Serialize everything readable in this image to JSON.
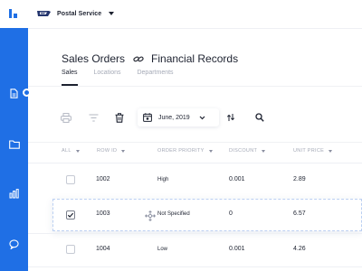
{
  "brand": {
    "name": "Postal Service"
  },
  "page": {
    "title_left": "Sales Orders",
    "title_right": "Financial Records"
  },
  "tabs": [
    {
      "label": "Sales",
      "active": true
    },
    {
      "label": "Locations",
      "active": false
    },
    {
      "label": "Departments",
      "active": false
    }
  ],
  "toolbar": {
    "date_label": "June, 2019"
  },
  "table": {
    "columns": [
      "ALL",
      "ROW ID",
      "ORDER PRIORITY",
      "DISCOUNT",
      "UNIT PRICE"
    ],
    "rows": [
      {
        "checked": false,
        "row_id": "1002",
        "priority": "High",
        "discount": "0.001",
        "unit_price": "2.89"
      },
      {
        "checked": true,
        "row_id": "1003",
        "priority": "Not Specified",
        "discount": "0",
        "unit_price": "6.57"
      },
      {
        "checked": false,
        "row_id": "1004",
        "priority": "Low",
        "discount": "0.001",
        "unit_price": "4.26"
      }
    ]
  },
  "colors": {
    "accent": "#1f6fe5",
    "text": "#1d2230",
    "muted": "#a5aab7"
  },
  "icons": [
    "logo-icon",
    "document-icon",
    "folder-icon",
    "bar-chart-icon",
    "chat-icon",
    "eagle-logo-icon",
    "link-icon",
    "print-icon",
    "filter-icon",
    "trash-icon",
    "calendar-icon",
    "sort-icon",
    "search-icon",
    "move-icon"
  ]
}
